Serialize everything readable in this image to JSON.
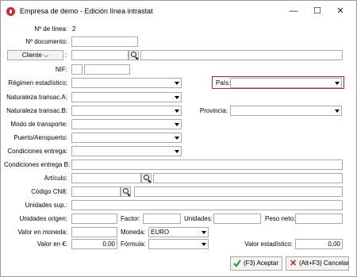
{
  "window": {
    "title": "Empresa de demo - Edición línea intrastat",
    "minimize": "—",
    "maximize": "☐",
    "close": "✕"
  },
  "fields": {
    "linea_label": "Nº de línea:",
    "linea_value": "2",
    "documento_label": "Nº documento:",
    "documento_value": "",
    "cliente_combo": "Cliente",
    "cliente_colon": ":",
    "cliente_code": "",
    "cliente_name": "",
    "nif_label": "NIF:",
    "regimen_label": "Régimen estadístico:",
    "natA_label": "Naturaleza transac.A:",
    "natB_label": "Naturaleza transac.B:",
    "transporte_label": "Modo de transporte:",
    "puerto_label": "Puerto/Aeropuerto:",
    "condiciones_label": "Condiciones entrega:",
    "condicionesB_label": "Condiciones entrega B:",
    "pais_label": "País:",
    "provincia_label": "Provincia:",
    "articulo_label": "Artículo:",
    "cn8_label": "Código CN8:",
    "unidades_sup_label": "Unidades sup.:",
    "unidades_origen_label": "Unidades origen:",
    "factor_label": "Factor:",
    "unidades_label": "Unidades:",
    "peso_label": "Peso neto:",
    "valor_moneda_label": "Valor en moneda:",
    "moneda_label": "Moneda:",
    "moneda_value": "EURO",
    "valor_eur_label": "Valor en €:",
    "valor_eur_value": "0,00",
    "formula_label": "Fórmula:",
    "valor_est_label": "Valor estadístico:",
    "valor_est_value": "0,00"
  },
  "buttons": {
    "accept": "(F3) Aceptar",
    "cancel": "(Alt+F3) Cancelar"
  },
  "colors": {
    "highlight": "#c2185b",
    "accept_icon": "#2e9d3a",
    "cancel_icon": "#d9202a"
  }
}
